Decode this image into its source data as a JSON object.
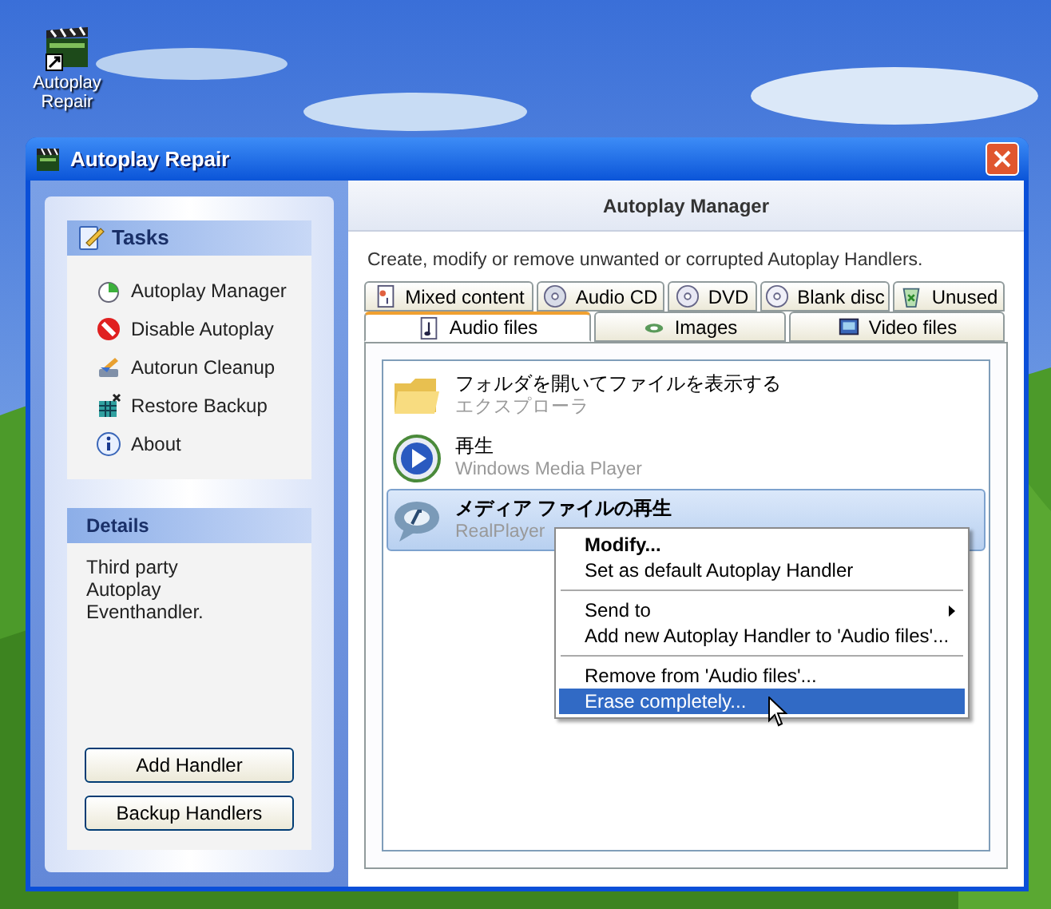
{
  "desktop_icon": {
    "label": "Autoplay Repair"
  },
  "window": {
    "title": "Autoplay Repair"
  },
  "tasks": {
    "title": "Tasks",
    "items": [
      {
        "label": "Autoplay Manager"
      },
      {
        "label": "Disable Autoplay"
      },
      {
        "label": "Autorun Cleanup"
      },
      {
        "label": "Restore Backup"
      },
      {
        "label": "About"
      }
    ]
  },
  "details": {
    "title": "Details",
    "text": "Third party Autoplay Eventhandler.",
    "buttons": [
      "Add Handler",
      "Backup Handlers"
    ]
  },
  "main": {
    "title": "Autoplay Manager",
    "description": "Create, modify or remove unwanted or corrupted Autoplay Handlers.",
    "tab_rows": [
      [
        {
          "label": "Mixed content",
          "selected": false
        },
        {
          "label": "Audio CD",
          "selected": false
        },
        {
          "label": "DVD",
          "selected": false
        },
        {
          "label": "Blank disc",
          "selected": false
        },
        {
          "label": "Unused",
          "selected": false
        }
      ],
      [
        {
          "label": "Audio files",
          "selected": true
        },
        {
          "label": "Images",
          "selected": false
        },
        {
          "label": "Video files",
          "selected": false
        }
      ]
    ],
    "handlers": [
      {
        "title": "フォルダを開いてファイルを表示する",
        "app": "エクスプローラ",
        "selected": false
      },
      {
        "title": "再生",
        "app": "Windows Media Player",
        "selected": false
      },
      {
        "title": "メディア ファイルの再生",
        "app": "RealPlayer",
        "selected": true
      }
    ]
  },
  "context_menu": {
    "sections": [
      [
        {
          "label": "Modify...",
          "default": true,
          "submenu": false,
          "selected": false
        },
        {
          "label": "Set as default Autoplay Handler",
          "default": false,
          "submenu": false,
          "selected": false
        }
      ],
      [
        {
          "label": "Send to",
          "default": false,
          "submenu": true,
          "selected": false
        },
        {
          "label": "Add new Autoplay Handler to 'Audio files'...",
          "default": false,
          "submenu": false,
          "selected": false
        }
      ],
      [
        {
          "label": "Remove from 'Audio files'...",
          "default": false,
          "submenu": false,
          "selected": false
        },
        {
          "label": "Erase completely...",
          "default": false,
          "submenu": false,
          "selected": true
        }
      ]
    ]
  }
}
